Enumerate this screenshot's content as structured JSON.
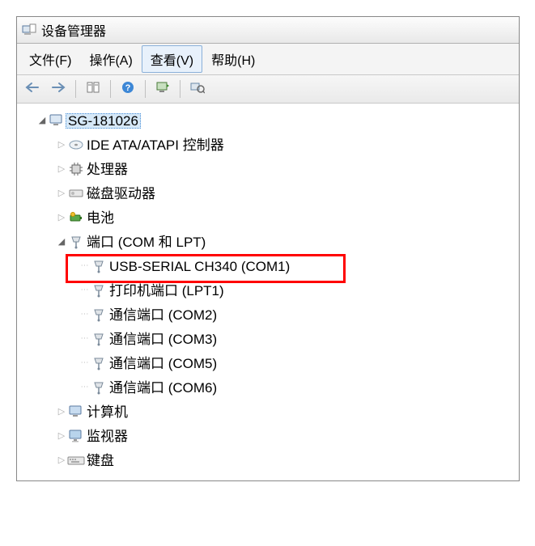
{
  "title": "设备管理器",
  "menu": {
    "file": "文件(F)",
    "action": "操作(A)",
    "view": "查看(V)",
    "help": "帮助(H)"
  },
  "icons": {
    "back": "back-arrow",
    "forward": "forward-arrow",
    "properties": "properties",
    "help": "help",
    "refresh": "refresh",
    "scan": "scan"
  },
  "tree": {
    "root": "SG-181026",
    "nodes": {
      "ide": "IDE ATA/ATAPI 控制器",
      "cpu": "处理器",
      "disk": "磁盘驱动器",
      "battery": "电池",
      "ports": "端口 (COM 和 LPT)",
      "port_items": {
        "usb_serial": "USB-SERIAL CH340 (COM1)",
        "printer": "打印机端口 (LPT1)",
        "com2": "通信端口 (COM2)",
        "com3": "通信端口 (COM3)",
        "com5": "通信端口 (COM5)",
        "com6": "通信端口 (COM6)"
      },
      "computer": "计算机",
      "monitor": "监视器",
      "keyboard": "键盘"
    }
  },
  "highlighted_item_path": "tree.nodes.port_items.usb_serial"
}
